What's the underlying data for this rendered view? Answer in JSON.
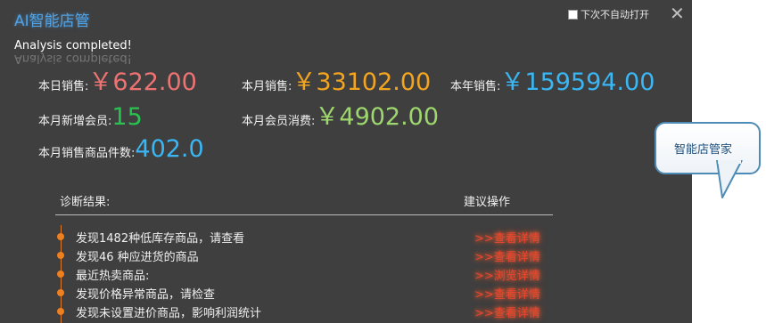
{
  "window": {
    "title": "AI智能店管",
    "auto_open_label": "下次不自动打开",
    "close_glyph": "✕",
    "status": "Analysis completed!"
  },
  "stats": {
    "today_sales": {
      "label": "本日销售:",
      "value": "￥622.00",
      "color": "#ee7272"
    },
    "month_sales": {
      "label": "本月销售:",
      "value": "￥33102.00",
      "color": "#f3a51f"
    },
    "year_sales": {
      "label": "本年销售:",
      "value": "￥159594.00",
      "color": "#3ab6f4"
    },
    "new_members": {
      "label": "本月新增会员:",
      "value": "15",
      "color": "#28c24e"
    },
    "member_spend": {
      "label": "本月会员消费:",
      "value": "￥4902.00",
      "color": "#9ed76d"
    },
    "items_sold": {
      "label": "本月销售商品件数:",
      "value": "402.0",
      "color": "#3ab6f4"
    }
  },
  "diagnosis": {
    "header": "诊断结果:",
    "action_header": "建议操作",
    "rows": [
      {
        "text": "发现1482种低库存商品，请查看",
        "action": ">>查看详情"
      },
      {
        "text": "发现46 种应进货的商品",
        "action": ">>查看详情"
      },
      {
        "text": "最近热卖商品:",
        "action": ">>浏览详情"
      },
      {
        "text": "发现价格异常商品，请检查",
        "action": ">>查看详情"
      },
      {
        "text": "发现未设置进价商品，影响利润统计",
        "action": ">>查看详情"
      }
    ]
  },
  "assistant": {
    "label": "智能店管家"
  }
}
